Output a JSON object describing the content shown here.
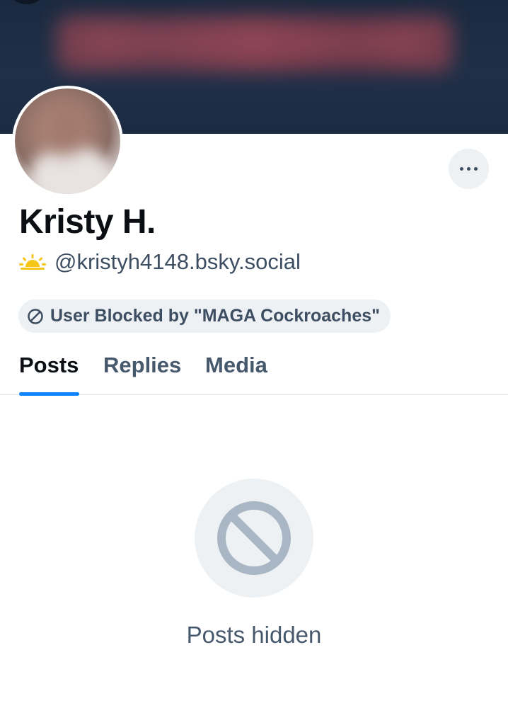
{
  "profile": {
    "display_name": "Kristy H.",
    "handle": "@kristyh4148.bsky.social",
    "handle_icon": "sunrise-icon",
    "moderation_label": "User Blocked by \"MAGA Cockroaches\"",
    "moderation_icon": "ban-icon"
  },
  "actions": {
    "more_icon": "more-options-icon"
  },
  "tabs": [
    {
      "label": "Posts",
      "active": true
    },
    {
      "label": "Replies",
      "active": false
    },
    {
      "label": "Media",
      "active": false
    }
  ],
  "empty_state": {
    "icon": "ban-icon",
    "message": "Posts hidden"
  },
  "colors": {
    "accent": "#1083fe",
    "banner": "#1e2f47",
    "muted_text": "#3e4e62",
    "pill_bg": "#eef1f4",
    "sun": "#f5c518"
  }
}
